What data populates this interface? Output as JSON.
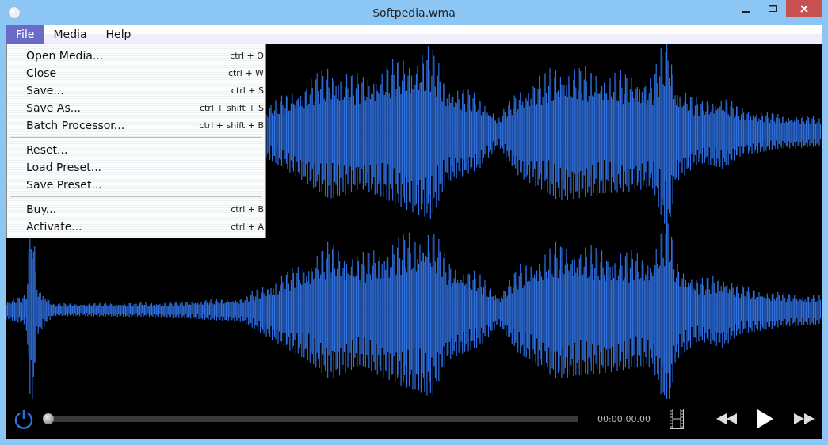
{
  "window": {
    "title": "Softpedia.wma"
  },
  "menu_bar": [
    {
      "label": "File",
      "selected": true
    },
    {
      "label": "Media",
      "selected": false
    },
    {
      "label": "Help",
      "selected": false
    }
  ],
  "file_menu": [
    [
      {
        "label": "Open Media...",
        "shortcut": "ctrl + O"
      },
      {
        "label": "Close",
        "shortcut": "ctrl + W"
      },
      {
        "label": "Save...",
        "shortcut": "ctrl + S"
      },
      {
        "label": "Save As...",
        "shortcut": "ctrl + shift + S"
      },
      {
        "label": "Batch Processor...",
        "shortcut": "ctrl + shift + B"
      }
    ],
    [
      {
        "label": "Reset..."
      },
      {
        "label": "Load Preset..."
      },
      {
        "label": "Save Preset..."
      }
    ],
    [
      {
        "label": "Buy...",
        "shortcut": "ctrl + B"
      },
      {
        "label": "Activate...",
        "shortcut": "ctrl + A"
      }
    ]
  ],
  "player": {
    "seek": {
      "level": 0
    },
    "time": "00:00:00.00"
  }
}
